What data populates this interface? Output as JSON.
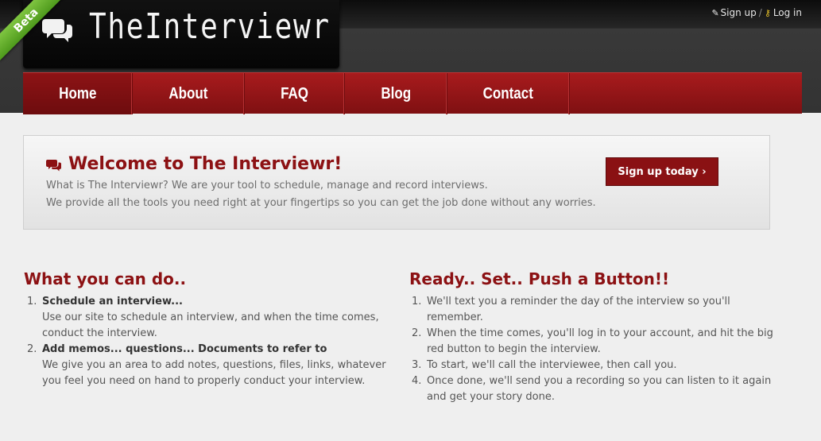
{
  "header": {
    "logo_text": "TheInterviewr",
    "ribbon": "Beta",
    "signup": "Sign up",
    "separator": "/",
    "login": "Log in"
  },
  "nav": [
    {
      "label": "Home",
      "active": true
    },
    {
      "label": "About"
    },
    {
      "label": "FAQ"
    },
    {
      "label": "Blog"
    },
    {
      "label": "Contact"
    }
  ],
  "welcome": {
    "title": "Welcome to The Interviewr!",
    "line1": "What is The Interviewr? We are your tool to schedule, manage and record interviews.",
    "line2": "We provide all the tools you need right at your fingertips so you can get the job done without any worries.",
    "button": "Sign up today ›"
  },
  "left": {
    "title": "What you can do..",
    "items": [
      {
        "num": "1.",
        "head": "Schedule an interview...",
        "l1": "Use our site to schedule an interview, and when the time comes,",
        "l2": "conduct the interview."
      },
      {
        "num": "2.",
        "head": "Add memos... questions... Documents to refer to",
        "l1": "We give you an area to add notes, questions, files, links, whatever",
        "l2": "you feel you need on hand to properly conduct your interview."
      }
    ]
  },
  "right": {
    "title": "Ready.. Set.. Push a Button!!",
    "items": [
      {
        "num": "1.",
        "l1": "We'll text you a reminder the day of the interview so you'll",
        "l2": "remember."
      },
      {
        "num": "2.",
        "l1": "When the time comes, you'll log in to your account, and hit the big",
        "l2": "red button to begin the interview."
      },
      {
        "num": "3.",
        "l1": "To start, we'll call the interviewee, then call you."
      },
      {
        "num": "4.",
        "l1": "Once done, we'll send you a recording so you can listen to it again",
        "l2": "and get your story done."
      }
    ]
  },
  "colors": {
    "brand_red": "#8c1113",
    "nav_red": "#a81b1d",
    "ribbon_green": "#5fae2b"
  },
  "icons": [
    "chat-bubbles-icon",
    "pencil-icon",
    "key-icon"
  ]
}
